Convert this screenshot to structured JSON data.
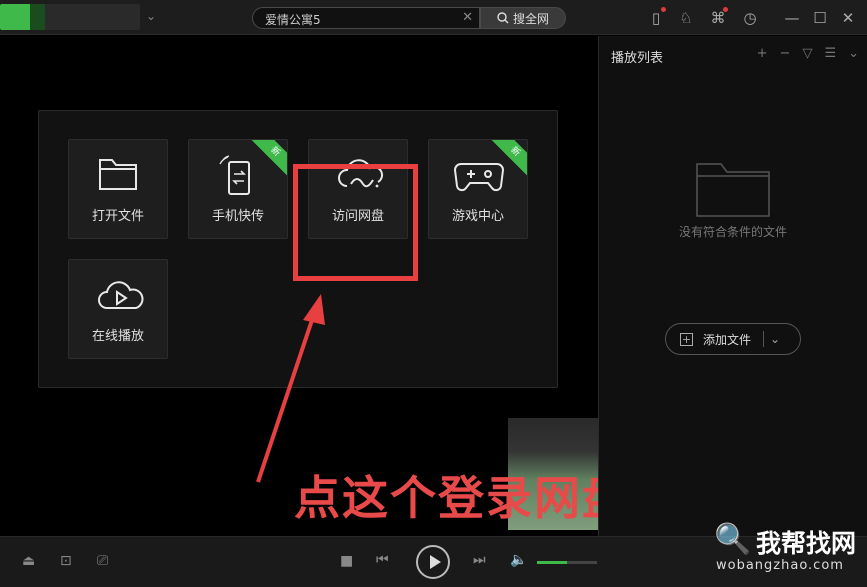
{
  "titlebar": {
    "search_value": "爱情公寓5",
    "search_button": "搜全网"
  },
  "tiles": [
    {
      "label": "打开文件",
      "icon": "folder-icon",
      "badge": ""
    },
    {
      "label": "手机快传",
      "icon": "phone-transfer-icon",
      "badge": "新"
    },
    {
      "label": "访问网盘",
      "icon": "cloud-icon",
      "badge": ""
    },
    {
      "label": "游戏中心",
      "icon": "gamepad-icon",
      "badge": "新"
    },
    {
      "label": "在线播放",
      "icon": "cloud-play-icon",
      "badge": ""
    }
  ],
  "annotation": "点这个登录网盘",
  "playlist": {
    "title": "播放列表",
    "empty_text": "没有符合条件的文件",
    "add_button": "添加文件"
  },
  "volume": {
    "level": 0.5
  },
  "watermark": {
    "text": "我帮找网",
    "domain": "wobangzhao.com"
  },
  "colors": {
    "accent": "#3fb94a",
    "highlight": "#e84040"
  }
}
